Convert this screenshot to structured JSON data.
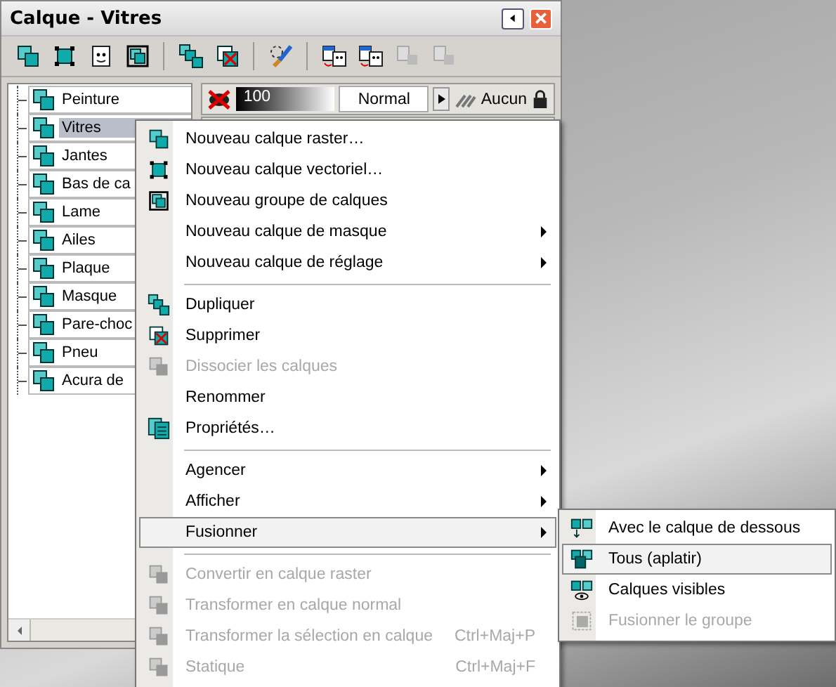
{
  "window": {
    "title": "Calque - Vitres"
  },
  "toolbar": [
    {
      "disabled": false
    },
    {
      "disabled": false
    },
    {
      "disabled": false
    },
    {
      "disabled": false
    },
    {
      "disabled": false
    },
    {
      "disabled": false
    },
    {
      "disabled": false
    },
    {
      "disabled": false
    },
    {
      "disabled": false
    },
    {
      "disabled": true
    },
    {
      "disabled": true
    }
  ],
  "layers": [
    {
      "name": "Peinture",
      "selected": false
    },
    {
      "name": "Vitres",
      "selected": true
    },
    {
      "name": "Jantes",
      "selected": false
    },
    {
      "name": "Bas de ca",
      "selected": false
    },
    {
      "name": "Lame",
      "selected": false
    },
    {
      "name": "Ailes",
      "selected": false
    },
    {
      "name": "Plaque",
      "selected": false
    },
    {
      "name": "Masque",
      "selected": false
    },
    {
      "name": "Pare-choc",
      "selected": false
    },
    {
      "name": "Pneu",
      "selected": false
    },
    {
      "name": "Acura de",
      "selected": false
    }
  ],
  "layer_properties": [
    {
      "visible": false,
      "opacity": "100",
      "level": 1,
      "blend_mode": "Normal",
      "mask": "Aucun"
    }
  ],
  "context_menu": [
    {
      "kind": "item",
      "label": "Nouveau calque raster…",
      "disabled": false,
      "submenu": false,
      "selected": false
    },
    {
      "kind": "item",
      "label": "Nouveau calque vectoriel…",
      "disabled": false,
      "submenu": false,
      "selected": false
    },
    {
      "kind": "item",
      "label": "Nouveau groupe de calques",
      "disabled": false,
      "submenu": false,
      "selected": false
    },
    {
      "kind": "item",
      "label": "Nouveau calque de masque",
      "disabled": false,
      "submenu": true,
      "selected": false
    },
    {
      "kind": "item",
      "label": "Nouveau calque de réglage",
      "disabled": false,
      "submenu": true,
      "selected": false
    },
    {
      "kind": "separator"
    },
    {
      "kind": "item",
      "label": "Dupliquer",
      "disabled": false,
      "submenu": false,
      "selected": false
    },
    {
      "kind": "item",
      "label": "Supprimer",
      "disabled": false,
      "submenu": false,
      "selected": false
    },
    {
      "kind": "item",
      "label": "Dissocier les calques",
      "disabled": true,
      "submenu": false,
      "selected": false
    },
    {
      "kind": "item",
      "label": "Renommer",
      "disabled": false,
      "submenu": false,
      "selected": false
    },
    {
      "kind": "item",
      "label": "Propriétés…",
      "disabled": false,
      "submenu": false,
      "selected": false
    },
    {
      "kind": "separator"
    },
    {
      "kind": "item",
      "label": "Agencer",
      "disabled": false,
      "submenu": true,
      "selected": false
    },
    {
      "kind": "item",
      "label": "Afficher",
      "disabled": false,
      "submenu": true,
      "selected": false
    },
    {
      "kind": "item",
      "label": "Fusionner",
      "disabled": false,
      "submenu": true,
      "selected": true
    },
    {
      "kind": "separator"
    },
    {
      "kind": "item",
      "label": "Convertir en calque raster",
      "disabled": true,
      "submenu": false,
      "selected": false
    },
    {
      "kind": "item",
      "label": "Transformer en calque normal",
      "disabled": true,
      "submenu": false,
      "selected": false
    },
    {
      "kind": "item",
      "label": "Transformer la sélection en calque",
      "shortcut": "Ctrl+Maj+P",
      "disabled": true,
      "submenu": false,
      "selected": false
    },
    {
      "kind": "item",
      "label": "Statique",
      "shortcut": "Ctrl+Maj+F",
      "disabled": true,
      "submenu": false,
      "selected": false
    }
  ],
  "submenu": [
    {
      "label": "Avec le calque de dessous",
      "disabled": false,
      "selected": false
    },
    {
      "label": "Tous (aplatir)",
      "disabled": false,
      "selected": true
    },
    {
      "label": "Calques visibles",
      "disabled": false,
      "selected": false
    },
    {
      "label": "Fusionner le groupe",
      "disabled": true,
      "selected": false
    }
  ]
}
